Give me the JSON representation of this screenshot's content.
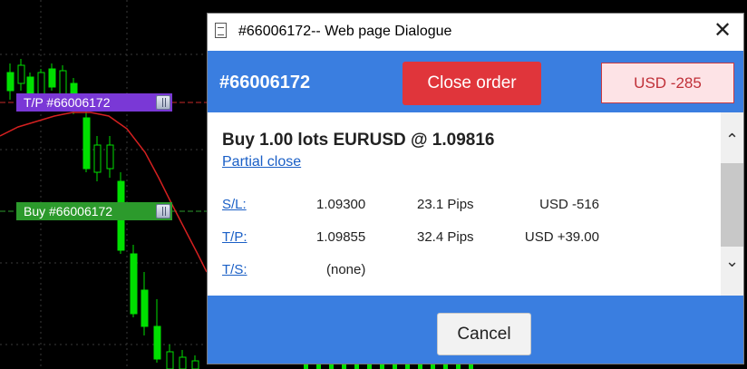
{
  "chart": {
    "tp_tag": "T/P #66006172",
    "buy_tag": "Buy #66006172",
    "tp_line_color": "#c62828",
    "buy_line_color": "#2c9a2c",
    "candle_color": "#00e000",
    "ma_color": "#d42020"
  },
  "dialog": {
    "title": "#66006172-- Web page Dialogue",
    "close_glyph": "✕",
    "order_id": "#66006172",
    "close_order_label": "Close order",
    "pl_badge": "USD -285",
    "summary": "Buy 1.00 lots EURUSD @ 1.09816",
    "partial_close": "Partial close",
    "rows": [
      {
        "label": "S/L:",
        "price": "1.09300",
        "pips": "23.1 Pips",
        "amount": "USD -516"
      },
      {
        "label": "T/P:",
        "price": "1.09855",
        "pips": "32.4 Pips",
        "amount": "USD +39.00"
      },
      {
        "label": "T/S:",
        "price": "(none)",
        "pips": "",
        "amount": ""
      }
    ],
    "scroll_up": "⌃",
    "scroll_down": "⌄",
    "cancel_label": "Cancel"
  },
  "colors": {
    "accent_blue": "#3a7ee0",
    "close_red": "#e0353b",
    "loss_text": "#c03038",
    "link_blue": "#1a5fc6"
  }
}
